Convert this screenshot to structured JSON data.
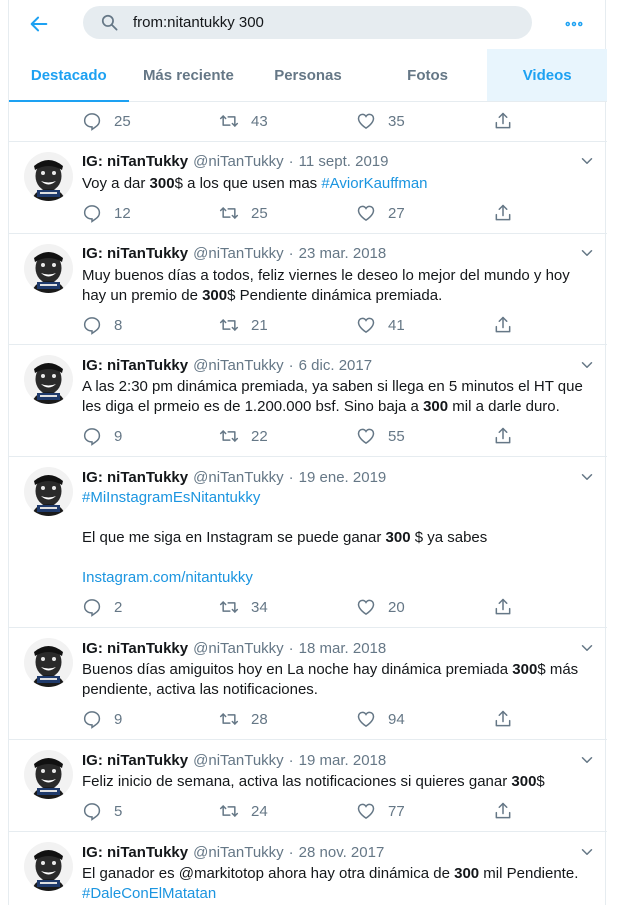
{
  "search": {
    "query": "from:nitantukky 300"
  },
  "tabs": [
    {
      "label": "Destacado"
    },
    {
      "label": "Más reciente"
    },
    {
      "label": "Personas"
    },
    {
      "label": "Fotos"
    },
    {
      "label": "Videos"
    }
  ],
  "partial_tweet": {
    "replies": "25",
    "retweets": "43",
    "likes": "35"
  },
  "tweets": [
    {
      "name": "IG: niTanTukky",
      "handle": "@niTanTukky",
      "date": "11 sept. 2019",
      "t1": "Voy a dar ",
      "b1": "300",
      "t2": "$ a los que usen mas  ",
      "hashtag": "#AviorKauffman",
      "replies": "12",
      "retweets": "25",
      "likes": "27"
    },
    {
      "name": "IG: niTanTukky",
      "handle": "@niTanTukky",
      "date": "23 mar. 2018",
      "t1": "Muy buenos días a todos, feliz viernes le deseo lo mejor del mundo y hoy hay un premio de ",
      "b1": "300",
      "t2": "$ Pendiente dinámica premiada.",
      "replies": "8",
      "retweets": "21",
      "likes": "41"
    },
    {
      "name": "IG: niTanTukky",
      "handle": "@niTanTukky",
      "date": "6 dic. 2017",
      "t1": "A las 2:30 pm dinámica premiada, ya saben si llega en 5 minutos el HT que les diga el prmeio es de 1.200.000 bsf. Sino baja a ",
      "b1": "300",
      "t2": " mil a darle duro.",
      "replies": "9",
      "retweets": "22",
      "likes": "55"
    },
    {
      "name": "IG: niTanTukky",
      "handle": "@niTanTukky",
      "date": "19 ene. 2019",
      "hashtag": "#MiInstagramEsNitantukky",
      "t1": "El que me siga en Instagram se puede ganar ",
      "b1": "300",
      "t2": " $ ya sabes",
      "link": "Instagram.com/nitantukky",
      "replies": "2",
      "retweets": "34",
      "likes": "20"
    },
    {
      "name": "IG: niTanTukky",
      "handle": "@niTanTukky",
      "date": "18 mar. 2018",
      "t1": "Buenos días amiguitos hoy en La noche hay dinámica premiada ",
      "b1": "300",
      "t2": "$ más pendiente, activa las notificaciones.",
      "replies": "9",
      "retweets": "28",
      "likes": "94"
    },
    {
      "name": "IG: niTanTukky",
      "handle": "@niTanTukky",
      "date": "19 mar. 2018",
      "t1": "Feliz inicio de semana, activa las notificaciones si quieres ganar ",
      "b1": "300",
      "t2": "$",
      "replies": "5",
      "retweets": "24",
      "likes": "77"
    },
    {
      "name": "IG: niTanTukky",
      "handle": "@niTanTukky",
      "date": "28 nov. 2017",
      "t1": "El ganador es @markitotop ahora hay otra dinámica de ",
      "b1": "300",
      "t2": " mil Pendiente.",
      "hashtag": "#DaleConElMatatan"
    }
  ],
  "colors": {
    "accent": "#1da1f2",
    "link": "#1b95e0",
    "muted": "#657786",
    "border": "#e6ecf0"
  }
}
